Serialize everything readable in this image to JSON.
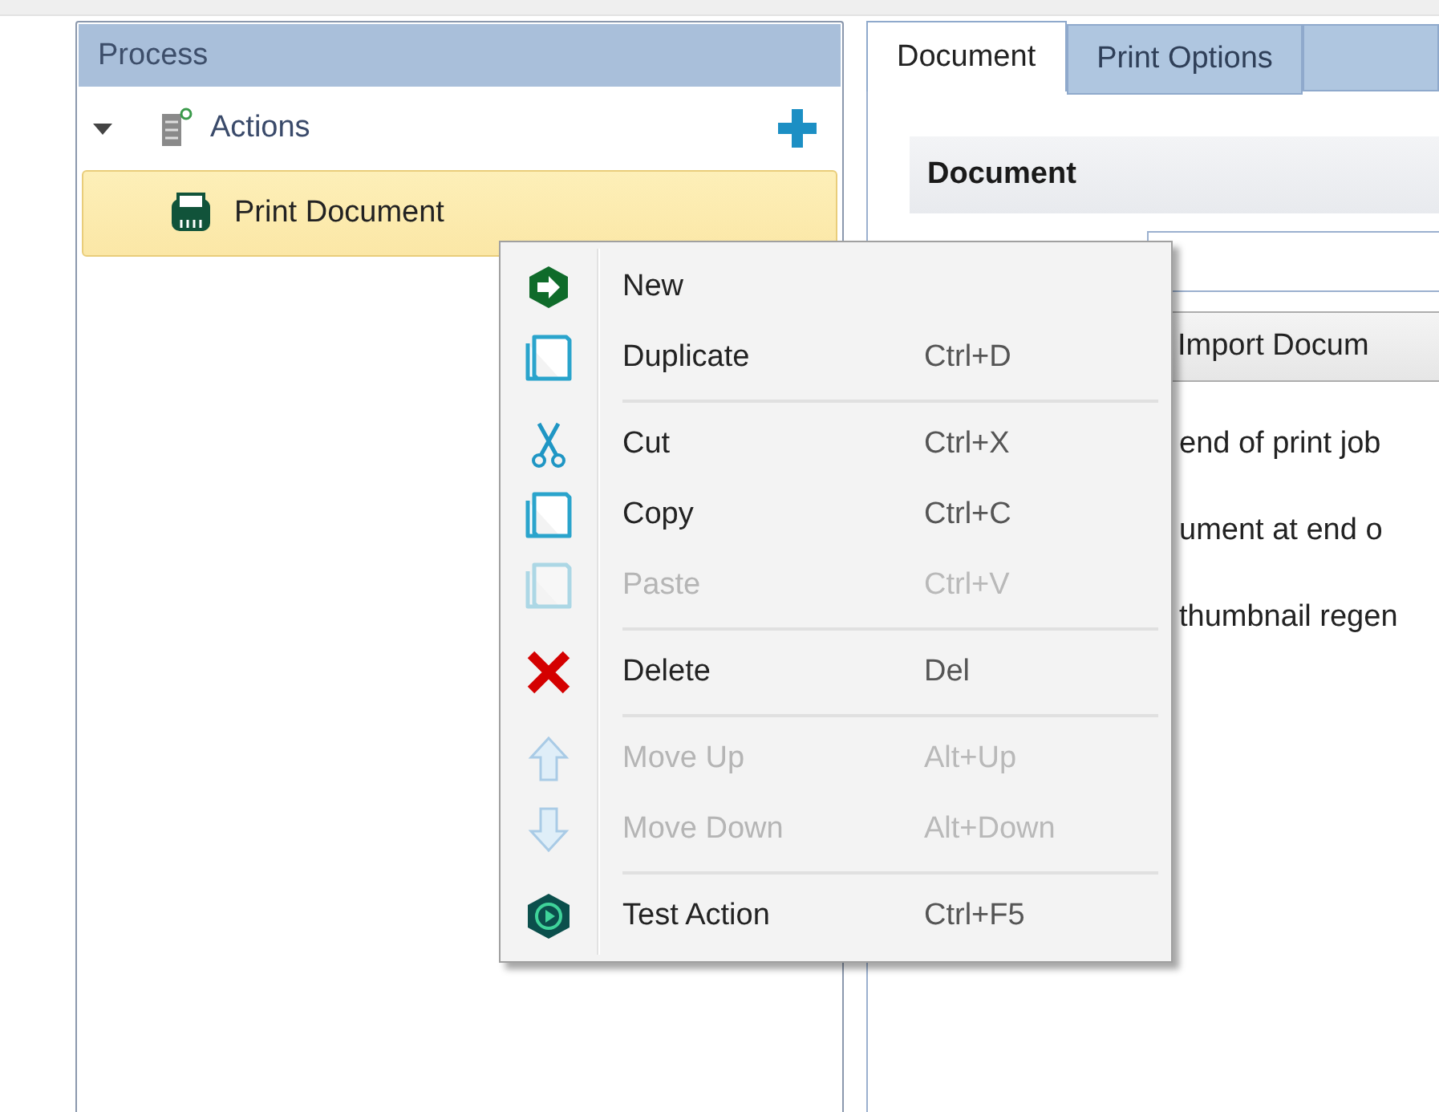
{
  "process_panel": {
    "title": "Process",
    "tree": [
      {
        "label": "Actions",
        "expanded": true,
        "children": [
          {
            "label": "Print Document",
            "selected": true
          }
        ]
      }
    ]
  },
  "tabs": [
    {
      "label": "Document",
      "selected": true
    },
    {
      "label": "Print Options",
      "selected": false
    }
  ],
  "document_section": {
    "title": "Document",
    "import_button": "Import Docum",
    "options": [
      "end of print job",
      "ument at end o",
      "thumbnail regen"
    ]
  },
  "context_menu": {
    "groups": [
      [
        {
          "label": "New",
          "disabled": false
        },
        {
          "label": "Duplicate",
          "shortcut": "Ctrl+D",
          "disabled": false
        }
      ],
      [
        {
          "label": "Cut",
          "shortcut": "Ctrl+X",
          "disabled": false
        },
        {
          "label": "Copy",
          "shortcut": "Ctrl+C",
          "disabled": false
        },
        {
          "label": "Paste",
          "shortcut": "Ctrl+V",
          "disabled": true
        }
      ],
      [
        {
          "label": "Delete",
          "shortcut": "Del",
          "disabled": false
        }
      ],
      [
        {
          "label": "Move Up",
          "shortcut": "Alt+Up",
          "disabled": true
        },
        {
          "label": "Move Down",
          "shortcut": "Alt+Down",
          "disabled": true
        }
      ],
      [
        {
          "label": "Test Action",
          "shortcut": "Ctrl+F5",
          "disabled": false
        }
      ]
    ]
  }
}
